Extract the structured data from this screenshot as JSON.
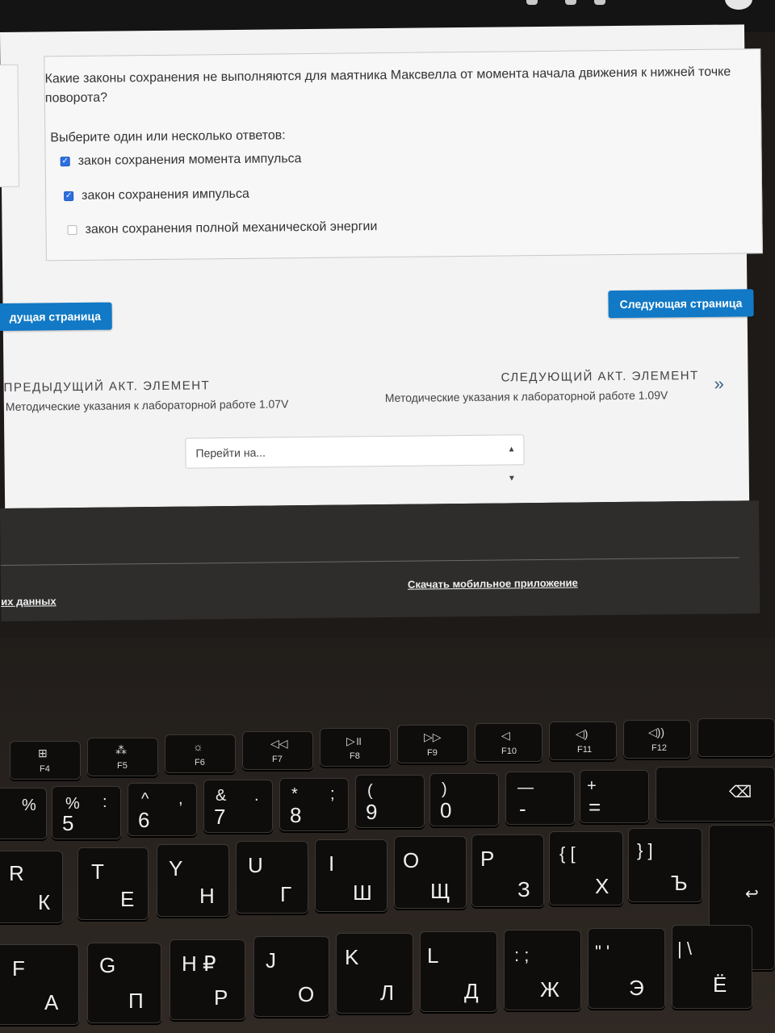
{
  "question": {
    "text": "Какие законы сохранения не выполняются для маятника Максвелла от момента начала движения к нижней точке поворота?",
    "prompt": "Выберите один или несколько ответов:",
    "answers": [
      {
        "label": "закон сохранения момента импульса",
        "checked": true
      },
      {
        "label": "закон сохранения импульса",
        "checked": true
      },
      {
        "label": "закон сохранения полной механической энергии",
        "checked": false
      }
    ]
  },
  "buttons": {
    "prev_page": "дущая страница",
    "next_page": "Следующая страница"
  },
  "activity_nav": {
    "prev_heading": "ПРЕДЫДУЩИЙ АКТ. ЭЛЕМЕНТ",
    "prev_title": "Методические указания к лабораторной работе 1.07V",
    "next_heading": "СЛЕДУЮЩИЙ АКТ. ЭЛЕМЕНТ",
    "next_title": "Методические указания к лабораторной работе 1.09V",
    "next_icon": "chevron-double-right-icon"
  },
  "jump_select": {
    "value": "Перейти на..."
  },
  "footer": {
    "data_link": "их данных",
    "mobile_app_link": "Скачать мобильное приложение"
  },
  "keyboard": {
    "fkeys": [
      "F4",
      "F5",
      "F6",
      "F7",
      "F8",
      "F9",
      "F10",
      "F11",
      "F12"
    ],
    "num_row": [
      {
        "top": "%",
        "bottom": "5",
        "alt": ":"
      },
      {
        "top": "^",
        "bottom": "6",
        "alt": ","
      },
      {
        "top": "&",
        "bottom": "7",
        "alt": "."
      },
      {
        "top": "*",
        "bottom": "8",
        "alt": ";"
      },
      {
        "top": "(",
        "bottom": "9",
        "alt": ""
      },
      {
        "top": ")",
        "bottom": "0",
        "alt": ""
      },
      {
        "top": "—",
        "bottom": "-",
        "alt": ""
      },
      {
        "top": "+",
        "bottom": "=",
        "alt": ""
      }
    ],
    "row2": [
      {
        "lat": "R",
        "cyr": "К"
      },
      {
        "lat": "T",
        "cyr": "Е"
      },
      {
        "lat": "Y",
        "cyr": "Н"
      },
      {
        "lat": "U",
        "cyr": "Г"
      },
      {
        "lat": "I",
        "cyr": "Ш"
      },
      {
        "lat": "O",
        "cyr": "Щ"
      },
      {
        "lat": "P",
        "cyr": "З"
      },
      {
        "lat": "{ [",
        "cyr": "Х"
      },
      {
        "lat": "} ]",
        "cyr": "Ъ"
      }
    ],
    "row3": [
      {
        "lat": "F",
        "cyr": "А"
      },
      {
        "lat": "G",
        "cyr": "П"
      },
      {
        "lat": "H ₽",
        "cyr": "Р"
      },
      {
        "lat": "J",
        "cyr": "О"
      },
      {
        "lat": "K",
        "cyr": "Л"
      },
      {
        "lat": "L",
        "cyr": "Д"
      },
      {
        "lat": ": ;",
        "cyr": "Ж"
      },
      {
        "lat": "\" '",
        "cyr": "Э"
      },
      {
        "lat": "| \\",
        "cyr": "Ё"
      }
    ],
    "misc": {
      "pct_left": "%",
      "dollar_left": "$"
    }
  }
}
